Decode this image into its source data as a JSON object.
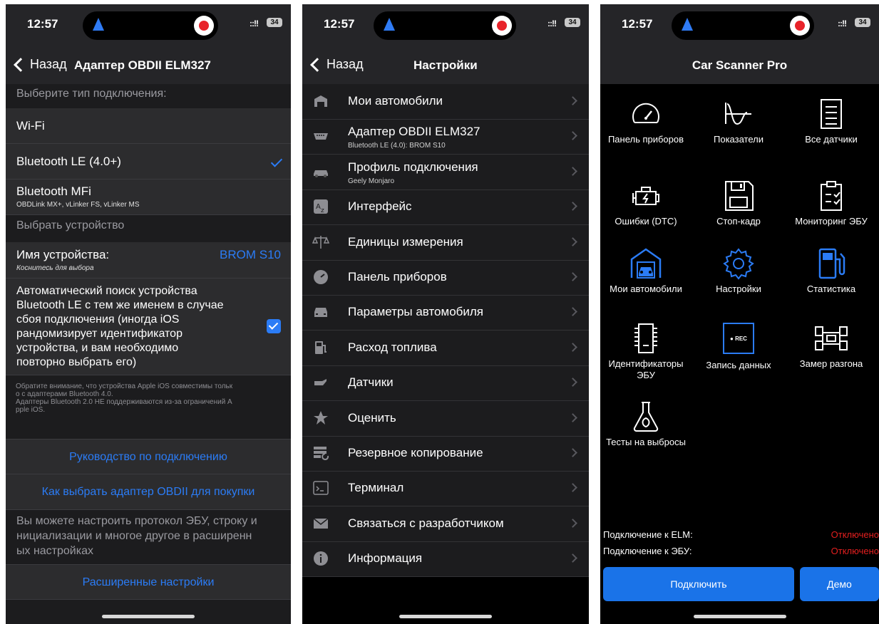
{
  "status": {
    "time": "12:57",
    "signal": "::!!",
    "battery": "34"
  },
  "panel1": {
    "back": "Назад",
    "title": "Адаптер OBDII ELM327",
    "section_connection": "Выберите тип подключения:",
    "wifi": "Wi-Fi",
    "ble": "Bluetooth LE (4.0+)",
    "mfi": "Bluetooth MFi",
    "mfi_sub": "OBDLink MX+, vLinker FS, vLinker MS",
    "section_device": "Выбрать устройство",
    "device_name_label": "Имя устройства:",
    "device_name_value": "BROM S10",
    "device_name_hint": "Коснитесь для выбора",
    "auto_search": [
      "Автоматический поиск устройства",
      "Bluetooth LE с тем же именем в случае",
      "сбоя подключения (иногда iOS",
      "рандомизирует идентификатор",
      "устройства, и вам необходимо",
      "повторно выбрать его)"
    ],
    "note": [
      "Обратите внимание, что устройства Apple iOS совместимы тольк",
      "о с адаптерами Bluetooth 4.0.",
      "Адаптеры Bluetooth 2.0 НЕ поддерживаются из-за ограничений A",
      "pple iOS."
    ],
    "guide_link": "Руководство по подключению",
    "buy_link": "Как выбрать адаптер OBDII для покупки",
    "advanced_text": [
      "Вы можете настроить протокол ЭБУ, строку и",
      "нициализации и многое другое в расширенн",
      "ых настройках"
    ],
    "advanced_link": "Расширенные настройки"
  },
  "panel2": {
    "back": "Назад",
    "title": "Настройки",
    "rows": [
      {
        "label": "Мои автомобили",
        "icon": "garage-icon"
      },
      {
        "label": "Адаптер OBDII ELM327",
        "sub": "Bluetooth LE (4.0): BROM S10",
        "icon": "obd-connector-icon"
      },
      {
        "label": "Профиль подключения",
        "sub": "Geely Monjaro",
        "icon": "car-icon"
      },
      {
        "label": "Интерфейс",
        "icon": "translate-icon"
      },
      {
        "label": "Единицы измерения",
        "icon": "scales-icon"
      },
      {
        "label": "Панель приборов",
        "icon": "speedometer-icon"
      },
      {
        "label": "Параметры автомобиля",
        "icon": "car-front-icon"
      },
      {
        "label": "Расход топлива",
        "icon": "fuel-pump-icon"
      },
      {
        "label": "Датчики",
        "icon": "oil-can-icon"
      },
      {
        "label": "Оценить",
        "icon": "star-icon"
      },
      {
        "label": "Резервное копирование",
        "icon": "backup-icon"
      },
      {
        "label": "Терминал",
        "icon": "terminal-icon"
      },
      {
        "label": "Связаться с разработчиком",
        "icon": "envelope-icon"
      },
      {
        "label": "Информация",
        "icon": "info-icon"
      }
    ]
  },
  "panel3": {
    "title": "Car Scanner Pro",
    "tiles": [
      {
        "label": "Панель приборов",
        "icon": "gauge-icon"
      },
      {
        "label": "Показатели",
        "icon": "graph-icon"
      },
      {
        "label": "Все датчики",
        "icon": "list-icon"
      },
      {
        "label": "Ошибки (DTC)",
        "icon": "engine-icon"
      },
      {
        "label": "Стоп-кадр",
        "icon": "floppy-icon"
      },
      {
        "label": "Мониторинг ЭБУ",
        "icon": "clipboard-check-icon"
      },
      {
        "label": "Мои автомобили",
        "icon": "garage-icon"
      },
      {
        "label": "Настройки",
        "icon": "gear-icon"
      },
      {
        "label": "Статистика",
        "icon": "fuel-pump-icon"
      },
      {
        "label": "Идентификаторы ЭБУ",
        "icon": "chip-icon"
      },
      {
        "label": "Запись данных",
        "icon": "rec-icon",
        "rec": "● REC"
      },
      {
        "label": "Замер разгона",
        "icon": "race-car-icon"
      },
      {
        "label": "Тесты на выбросы",
        "icon": "flask-leaf-icon"
      }
    ],
    "elm_label": "Подключение к ELM:",
    "elm_value": "Отключено",
    "ecu_label": "Подключение к ЭБУ:",
    "ecu_value": "Отключено",
    "connect": "Подключить",
    "demo": "Демо"
  },
  "colors": {
    "accent": "#2b7cf6",
    "error": "#e41f1f",
    "nav_bg": "#252528",
    "cell_bg": "#2c2c2e"
  }
}
